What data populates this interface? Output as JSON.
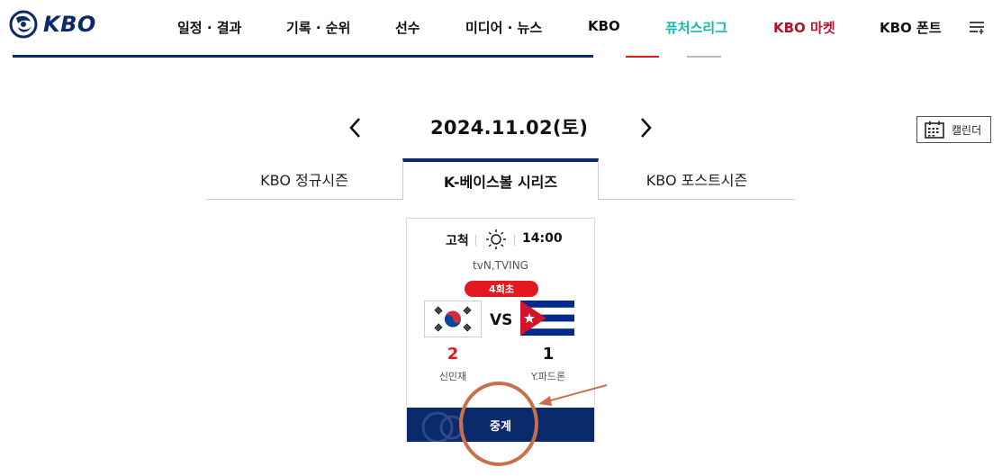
{
  "header": {
    "logo_text": "KBO",
    "nav": [
      {
        "label": "일정 · 결과",
        "key": "schedule"
      },
      {
        "label": "기록 · 순위",
        "key": "records"
      },
      {
        "label": "선수",
        "key": "players"
      },
      {
        "label": "미디어 · 뉴스",
        "key": "media"
      },
      {
        "label": "KBO",
        "key": "kbo"
      },
      {
        "label": "퓨처스리그",
        "key": "futures"
      },
      {
        "label": "KBO 마켓",
        "key": "market"
      },
      {
        "label": "KBO 폰트",
        "key": "font"
      }
    ],
    "accent_color": "#0b2a6b",
    "futures_color": "#13b8b0",
    "market_color": "#b3122a"
  },
  "date_nav": {
    "date": "2024.11.02(토)",
    "calendar_label": "캘린더"
  },
  "tabs": [
    {
      "label": "KBO 정규시즌",
      "active": false
    },
    {
      "label": "K-베이스볼 시리즈",
      "active": true
    },
    {
      "label": "KBO 포스트시즌",
      "active": false
    }
  ],
  "game": {
    "stadium": "고척",
    "weather": "sun-icon",
    "time": "14:00",
    "broadcast": "tvN,TVING",
    "status": "4회초",
    "vs_label": "VS",
    "home": {
      "flag": "korea-flag-icon",
      "score": "2",
      "pitcher": "신민재"
    },
    "away": {
      "flag": "cuba-flag-icon",
      "score": "1",
      "pitcher": "Y.파드론"
    },
    "relay_label": "중계",
    "status_color": "#e3191f"
  },
  "annotation": {
    "type": "circle-and-arrow",
    "color": "#c8704a",
    "target": "relay-button"
  }
}
